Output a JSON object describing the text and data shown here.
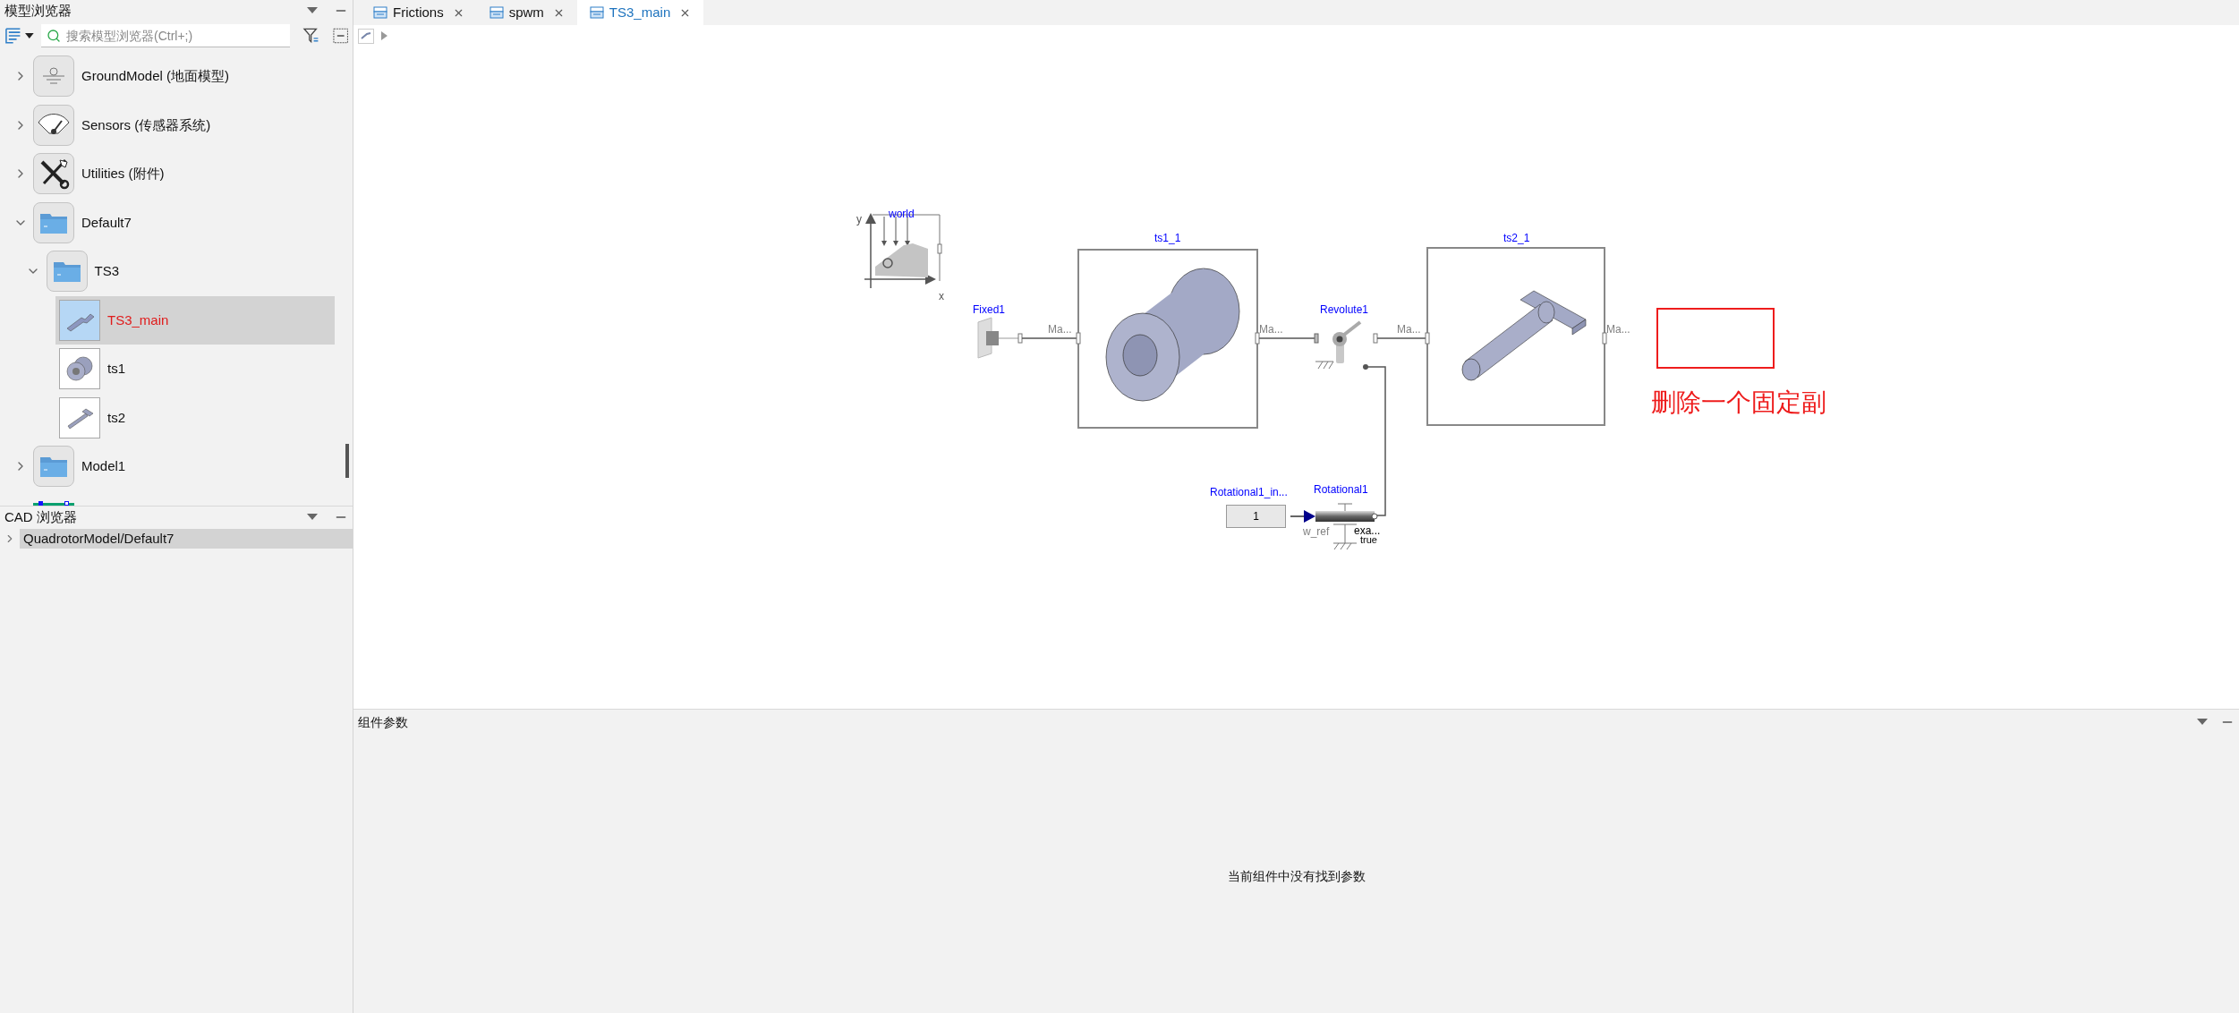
{
  "model_browser": {
    "title": "模型浏览器",
    "search": {
      "placeholder": "搜索模型浏览器(Ctrl+;)"
    },
    "tree": [
      {
        "kind": "ground",
        "label": "GroundModel (地面模型)",
        "expanded": false,
        "selected": false
      },
      {
        "kind": "sensors",
        "label": "Sensors (传感器系统)",
        "expanded": false,
        "selected": false
      },
      {
        "kind": "utilities",
        "label": "Utilities (附件)",
        "expanded": false,
        "selected": false
      },
      {
        "kind": "folder",
        "label": "Default7",
        "expanded": true,
        "selected": false,
        "children": [
          {
            "kind": "folder",
            "label": "TS3",
            "expanded": true,
            "selected": false,
            "children": [
              {
                "kind": "assembly",
                "label": "TS3_main",
                "selected": true
              },
              {
                "kind": "cylinder_part",
                "label": "ts1",
                "selected": false
              },
              {
                "kind": "rod_part",
                "label": "ts2",
                "selected": false
              }
            ]
          }
        ]
      },
      {
        "kind": "folder",
        "label": "Model1",
        "expanded": false,
        "selected": false
      },
      {
        "kind": "battery"
      }
    ]
  },
  "cad_browser": {
    "title": "CAD 浏览器",
    "items": [
      {
        "label": "QuadrotorModel/Default7",
        "expanded": false,
        "selected": true
      }
    ]
  },
  "tabs": [
    {
      "label": "Frictions",
      "selected": false
    },
    {
      "label": "spwm",
      "selected": false
    },
    {
      "label": "TS3_main",
      "selected": true
    }
  ],
  "diagram": {
    "components": [
      {
        "kind": "world",
        "label": "world",
        "x_axis": "x",
        "y_axis": "y"
      },
      {
        "kind": "fixed",
        "label": "Fixed1"
      },
      {
        "kind": "body_cylinder",
        "label": "ts1_1",
        "port_left": "Ma...",
        "port_right": "Ma..."
      },
      {
        "kind": "revolute",
        "label": "Revolute1"
      },
      {
        "kind": "body_rod",
        "label": "ts2_1",
        "port_left": "Ma...",
        "port_right": "Ma..."
      },
      {
        "kind": "constant",
        "label": "Rotational1_in...",
        "value": "1"
      },
      {
        "kind": "speed",
        "label": "Rotational1",
        "port": "w_ref",
        "param_1": "exa...",
        "param_2": "true"
      }
    ],
    "annotation": {
      "text": "删除一个固定副"
    }
  },
  "parameters_panel": {
    "title": "组件参数",
    "message": "当前组件中没有找到参数"
  }
}
